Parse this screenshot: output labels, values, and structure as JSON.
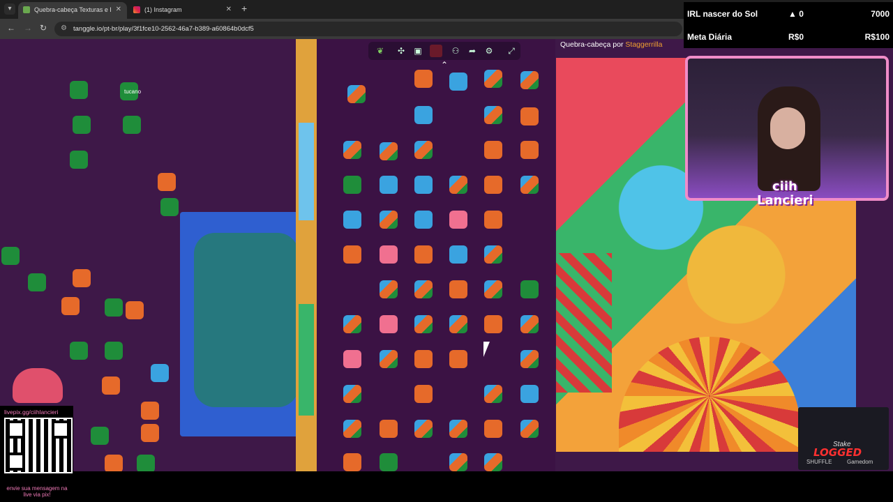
{
  "browser": {
    "tabs": [
      {
        "title": "Quebra-cabeça Texturas e P",
        "active": true
      },
      {
        "title": "(1) Instagram",
        "active": false
      }
    ],
    "url": "tanggle.io/pt-br/play/3f1fce10-2562-46a7-b389-a60864b0dcf5"
  },
  "game": {
    "player_tag": "tucano",
    "reference": {
      "label": "Quebra-cabeça por",
      "author": "Staggerrilla"
    }
  },
  "overlay": {
    "goals": [
      {
        "name": "IRL nascer do Sol",
        "mid": "0",
        "value": "7000"
      },
      {
        "name": "Meta Diária",
        "mid": "R$0",
        "value": "R$100"
      }
    ],
    "cam_name_line1": "ciih",
    "cam_name_line2": "Lancieri",
    "qr_title": "livepix.gg/ciihlancieri",
    "qr_footer": "envie sua mensagem na live via pix!",
    "sponsor": {
      "brand": "Stake",
      "logo": "LOGGED",
      "partner1": "SHUFFLE",
      "partner2": "Gamedom"
    }
  },
  "icons": [
    "tab-scroll-icon",
    "favicon-icon",
    "close-icon",
    "plus-icon",
    "back-icon",
    "forward-icon",
    "reload-icon",
    "site-info-icon",
    "leaf-icon",
    "puzzle-icon",
    "image-icon",
    "color-icon",
    "players-icon",
    "share-icon",
    "settings-icon",
    "fullscreen-icon",
    "chevron-up-icon",
    "cursor-icon"
  ],
  "colors": {
    "game_bg": "#3e1848",
    "author": "#f0a030",
    "overlay_pink": "#f07ab8",
    "webcam_border": "#f08cc8"
  }
}
